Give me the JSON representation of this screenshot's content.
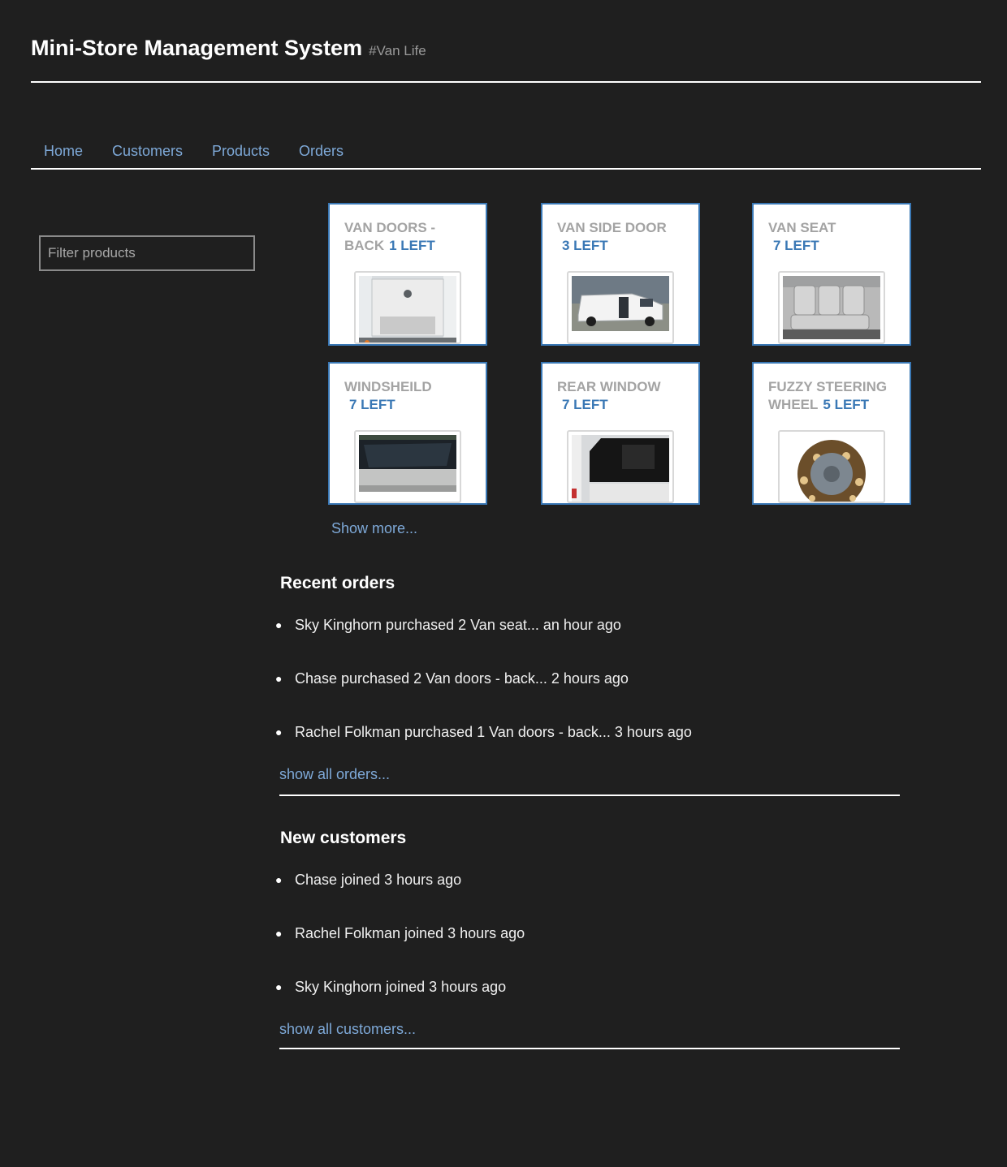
{
  "header": {
    "title": "Mini-Store Management System",
    "tag": "#Van Life"
  },
  "nav": {
    "items": [
      "Home",
      "Customers",
      "Products",
      "Orders"
    ]
  },
  "filter": {
    "placeholder": "Filter products",
    "value": ""
  },
  "products": [
    {
      "name": "Van doors - back",
      "stock": "1 LEFT",
      "image": "van-doors-back-photo"
    },
    {
      "name": "Van side door",
      "stock": "3 LEFT",
      "image": "van-side-door-photo"
    },
    {
      "name": "Van seat",
      "stock": "7 LEFT",
      "image": "van-seat-photo"
    },
    {
      "name": "Windsheild",
      "stock": "7 LEFT",
      "image": "windsheild-photo"
    },
    {
      "name": "Rear window",
      "stock": "7 LEFT",
      "image": "rear-window-photo"
    },
    {
      "name": "Fuzzy steering wheel",
      "stock": "5 LEFT",
      "image": "fuzzy-steering-wheel-photo"
    }
  ],
  "products_more": "Show more...",
  "recent_orders": {
    "title": "Recent orders",
    "items": [
      "Sky Kinghorn purchased 2 Van seat... an hour ago",
      "Chase purchased 2 Van doors - back... 2 hours ago",
      "Rachel Folkman purchased 1 Van doors - back... 3 hours ago"
    ],
    "show_all": "show all orders..."
  },
  "new_customers": {
    "title": "New customers",
    "items": [
      "Chase joined 3 hours ago",
      "Rachel Folkman joined 3 hours ago",
      "Sky Kinghorn joined 3 hours ago"
    ],
    "show_all": "show all customers..."
  },
  "colors": {
    "background": "#1f1f1f",
    "link": "#7ea9d8",
    "card_border": "#3a78b5",
    "stock": "#3a78b5",
    "card_title": "#a3a3a3"
  }
}
